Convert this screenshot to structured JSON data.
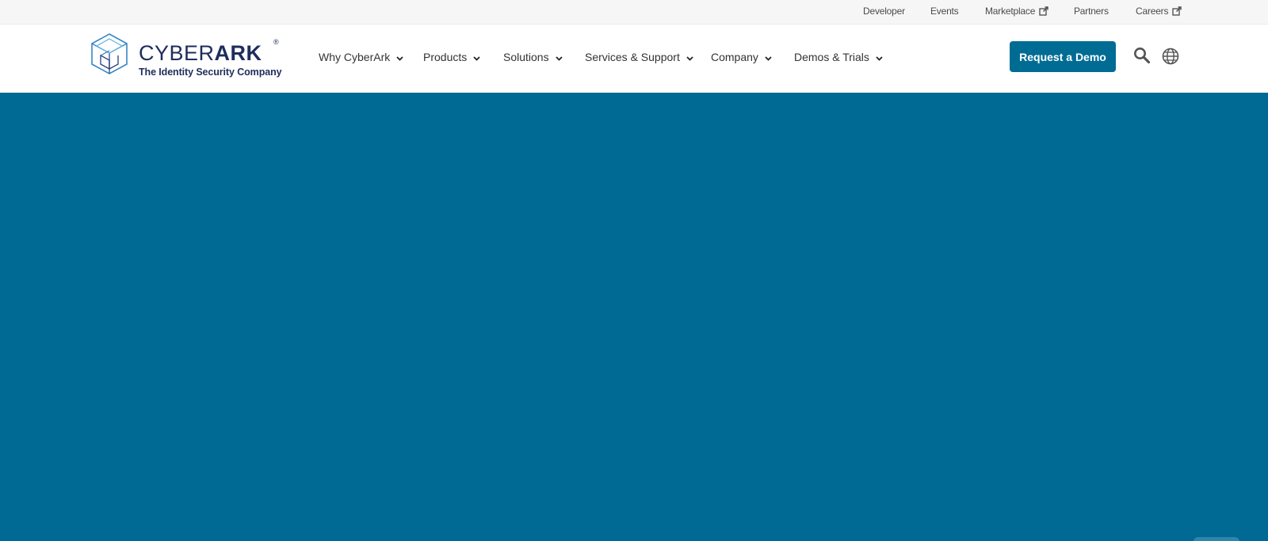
{
  "utility_nav": {
    "developer": "Developer",
    "events": "Events",
    "marketplace": "Marketplace",
    "partners": "Partners",
    "careers": "Careers"
  },
  "brand": {
    "name_light": "CYBER",
    "name_bold": "ARK",
    "registered": "®",
    "tagline": "The Identity Security Company"
  },
  "main_nav": {
    "why_cyberark": "Why CyberArk",
    "products": "Products",
    "solutions": "Solutions",
    "services_support": "Services & Support",
    "company": "Company",
    "demos_trials": "Demos & Trials"
  },
  "header_actions": {
    "request_demo": "Request a Demo",
    "search_icon": "search-icon",
    "globe_icon": "globe-icon"
  },
  "colors": {
    "brand_blue": "#006c94",
    "hero_blue": "#006a94",
    "navy": "#1e2d5c"
  }
}
